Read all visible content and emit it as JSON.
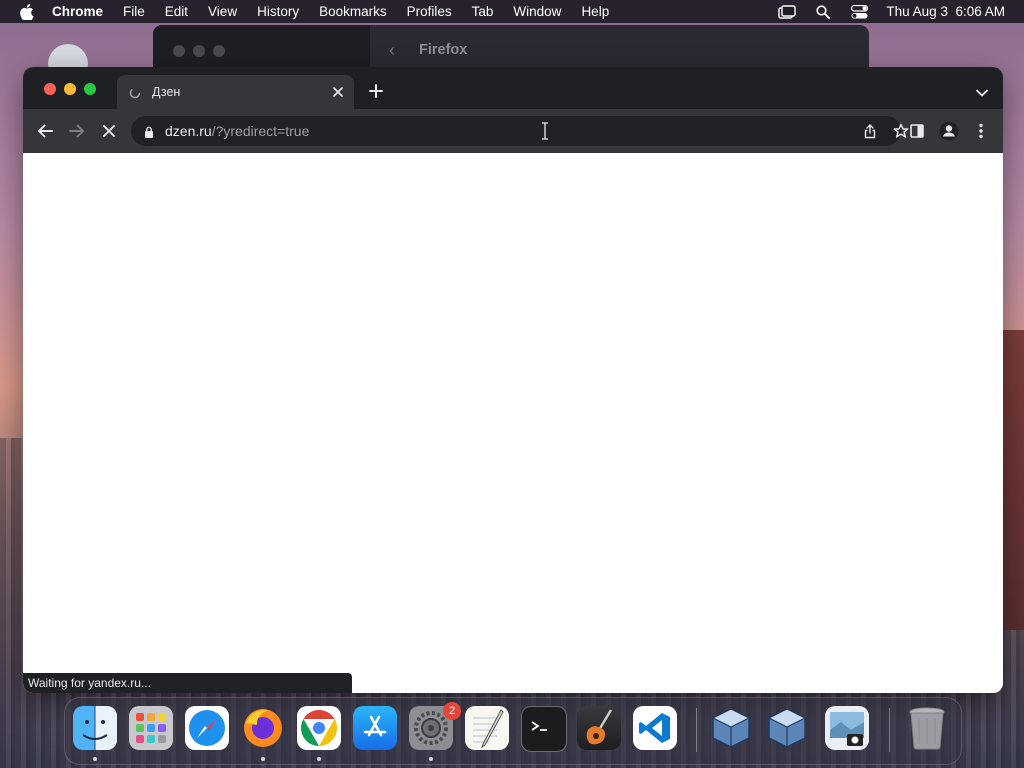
{
  "menubar": {
    "app_name": "Chrome",
    "items": [
      "File",
      "Edit",
      "View",
      "History",
      "Bookmarks",
      "Profiles",
      "Tab",
      "Window",
      "Help"
    ],
    "clock": "Thu Aug 3  6:06 AM"
  },
  "background_window": {
    "title": "Firefox"
  },
  "browser": {
    "tab": {
      "title": "Дзен"
    },
    "address": {
      "host": "dzen.ru",
      "path": "/?yredirect=true"
    },
    "status_text": "Waiting for yandex.ru..."
  },
  "dock": {
    "apps": [
      {
        "name": "Finder",
        "icon": "finder-icon",
        "running": true
      },
      {
        "name": "Launchpad",
        "icon": "launchpad-icon",
        "running": false
      },
      {
        "name": "Safari",
        "icon": "safari-icon",
        "running": false
      },
      {
        "name": "Firefox",
        "icon": "firefox-icon",
        "running": true
      },
      {
        "name": "Chrome",
        "icon": "chrome-icon",
        "running": true
      },
      {
        "name": "App Store",
        "icon": "app-store-icon",
        "running": false
      },
      {
        "name": "System Settings",
        "icon": "settings-icon",
        "running": true,
        "badge": "2"
      },
      {
        "name": "TextEdit",
        "icon": "textedit-icon",
        "running": false
      },
      {
        "name": "Terminal",
        "icon": "terminal-icon",
        "running": false
      },
      {
        "name": "GarageBand",
        "icon": "garageband-icon",
        "running": false
      },
      {
        "name": "Visual Studio Code",
        "icon": "vscode-icon",
        "running": false
      },
      {
        "name": "VirtualBox",
        "icon": "virtualbox-icon",
        "running": false
      },
      {
        "name": "VirtualBox",
        "icon": "virtualbox-icon",
        "running": false
      },
      {
        "name": "Preview",
        "icon": "preview-icon",
        "running": false
      },
      {
        "name": "Trash",
        "icon": "trash-icon",
        "running": false
      }
    ]
  },
  "colors": {
    "chrome_frame": "#1f2023",
    "chrome_toolbar": "#35363a",
    "omnibox": "#202124",
    "close": "#ff5f57",
    "minimize": "#febc2e",
    "zoom": "#28c840"
  }
}
